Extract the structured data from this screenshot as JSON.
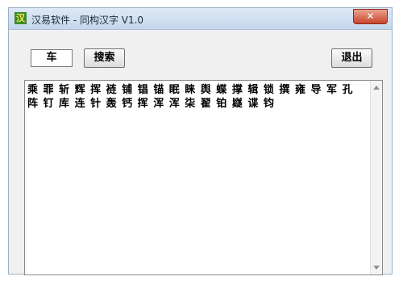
{
  "window": {
    "title": "汉易软件 - 同构汉字 V1.0",
    "icon_glyph": "汉",
    "close_glyph": "✕"
  },
  "search": {
    "value": "车",
    "button_label": "搜索"
  },
  "toolbar": {
    "exit_label": "退出"
  },
  "results": {
    "text": "乘 罪 斩 辉 挥 裢 铺 锠 锚 眠 睐 舆 蝶 撑 辑 锁 撰 雍 导 军 孔 阵 钉 库 连 针 轰 钙 挥 浑 浑 柒 翟 铂 嶷 谍 钧"
  },
  "colors": {
    "close_button": "#c9452d",
    "titlebar": "#c4d6ec",
    "window_bg": "#f0f0f0"
  }
}
